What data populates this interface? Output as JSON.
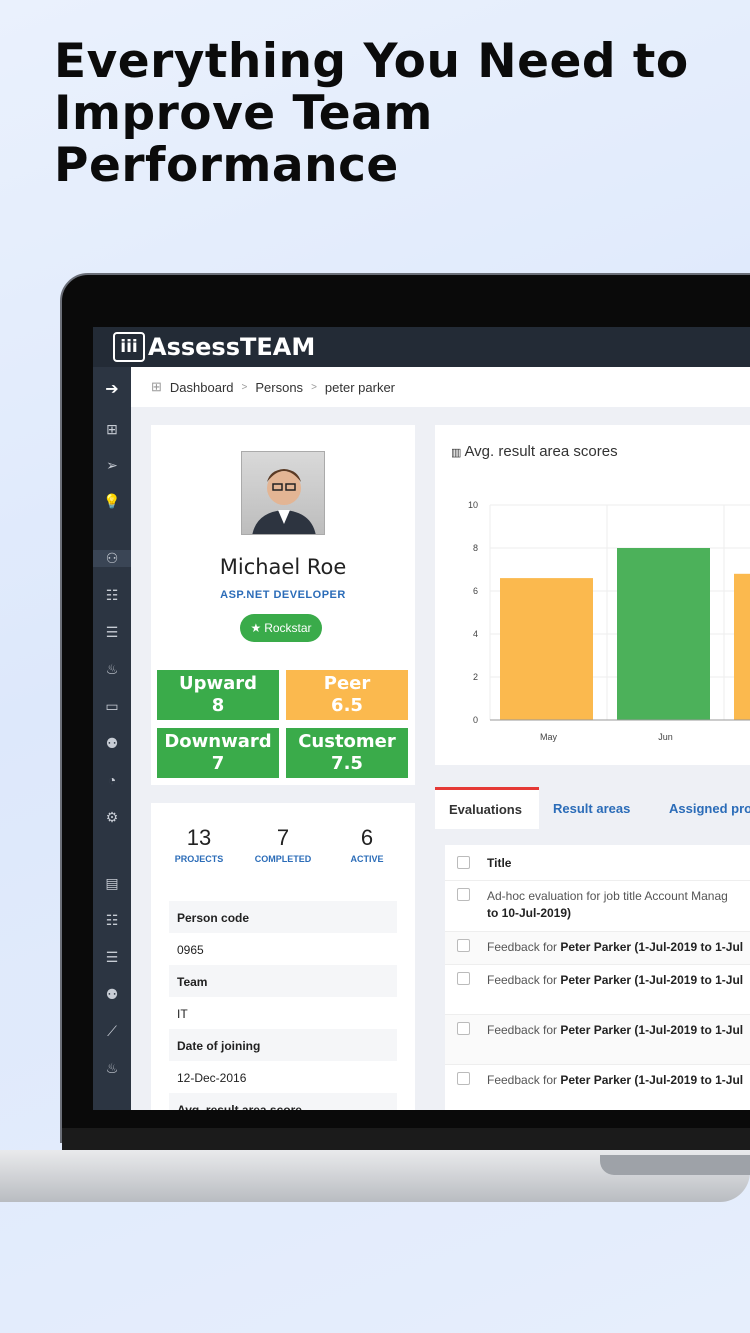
{
  "headline": "Everything You Need to Improve Team Performance",
  "app": {
    "logo_text": "AssessTEAM",
    "logo_mark": "iii"
  },
  "breadcrumb": [
    "Dashboard",
    "Persons",
    "peter parker"
  ],
  "profile": {
    "name": "Michael Roe",
    "role": "ASP.NET DEVELOPER",
    "badge": "Rockstar",
    "scores": [
      {
        "label": "Upward",
        "value": "8",
        "color": "#3aab4a"
      },
      {
        "label": "Peer",
        "value": "6.5",
        "color": "#fbb94e"
      },
      {
        "label": "Downward",
        "value": "7",
        "color": "#3aab4a"
      },
      {
        "label": "Customer",
        "value": "7.5",
        "color": "#3aab4a"
      }
    ]
  },
  "stats": [
    {
      "value": "13",
      "label": "PROJECTS"
    },
    {
      "value": "7",
      "label": "COMPLETED"
    },
    {
      "value": "6",
      "label": "ACTIVE"
    }
  ],
  "details": [
    {
      "label": "Person code",
      "value": "0965"
    },
    {
      "label": "Team",
      "value": "IT"
    },
    {
      "label": "Date of joining",
      "value": "12-Dec-2016"
    },
    {
      "label": "Avg. result area score",
      "value": ""
    }
  ],
  "chart_data": {
    "type": "bar",
    "title": "Avg. result area scores",
    "categories": [
      "May",
      "Jun",
      ""
    ],
    "values": [
      6.6,
      8,
      6.8
    ],
    "colors": [
      "#fbb94e",
      "#4cb15a",
      "#fbb94e"
    ],
    "ylim": [
      0,
      10
    ],
    "yticks": [
      0,
      2,
      4,
      6,
      8,
      10
    ],
    "grid": true
  },
  "tabs": [
    {
      "label": "Evaluations",
      "active": true
    },
    {
      "label": "Result areas",
      "active": false
    },
    {
      "label": "Assigned pro",
      "active": false
    }
  ],
  "table": {
    "header": "Title",
    "rows": [
      {
        "prefix": "Ad-hoc evaluation for job title Account Manag",
        "bold": "to 10-Jul-2019)"
      },
      {
        "prefix": "Feedback for ",
        "bold": "Peter Parker (1-Jul-2019 to 1-Jul"
      },
      {
        "prefix": "Feedback for ",
        "bold": "Peter Parker (1-Jul-2019 to 1-Jul"
      },
      {
        "prefix": "Feedback for ",
        "bold": "Peter Parker (1-Jul-2019 to 1-Jul"
      },
      {
        "prefix": "Feedback for ",
        "bold": "Peter Parker (1-Jul-2019 to 1-Jul"
      }
    ]
  },
  "sidebar_icons": [
    "arrow-right-icon",
    "grid-icon",
    "send-icon",
    "bulb-icon",
    "person-icon",
    "sliders-icon",
    "list-icon",
    "fire-icon",
    "card-icon",
    "team-icon",
    "gauge-icon",
    "gear-icon",
    "table-icon",
    "sliders-icon",
    "list-icon",
    "team-icon",
    "line-chart-icon",
    "fire-icon"
  ]
}
